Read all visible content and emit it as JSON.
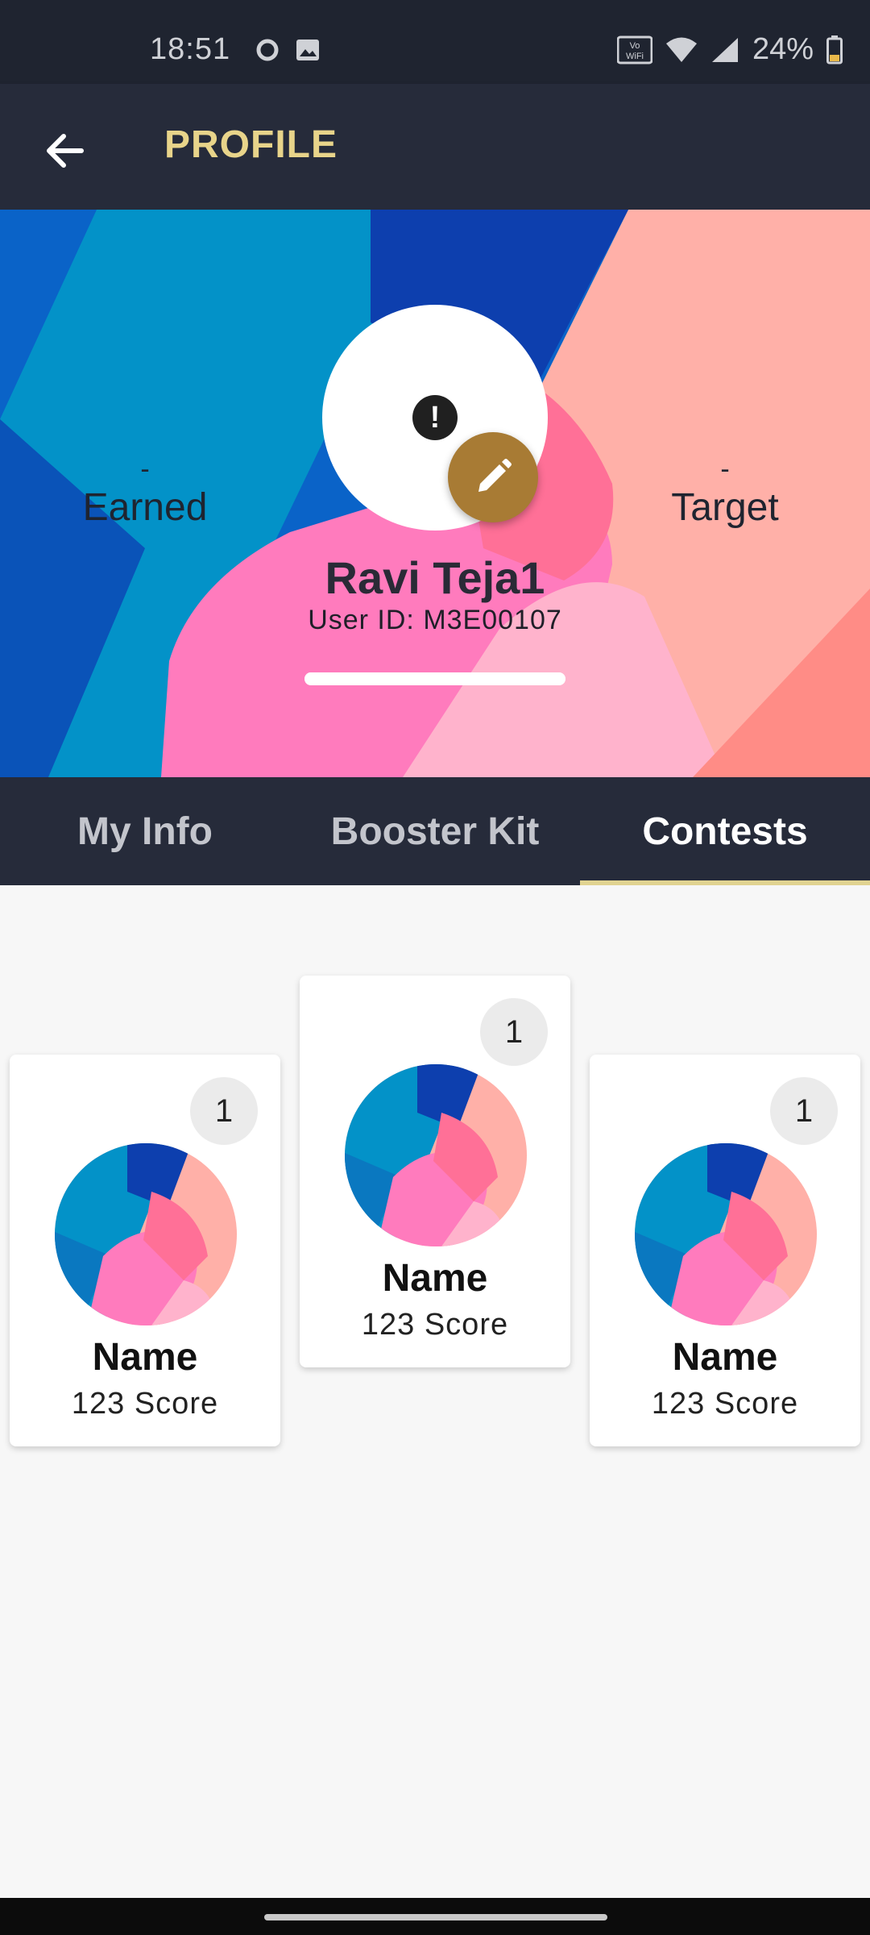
{
  "status_bar": {
    "time": "18:51",
    "battery": "24%"
  },
  "app_bar": {
    "title": "PROFILE"
  },
  "profile": {
    "earned_value": "-",
    "earned_label": "Earned",
    "target_value": "-",
    "target_label": "Target",
    "name": "Ravi Teja1",
    "user_id": "User ID: M3E00107",
    "progress_fraction": 1.0
  },
  "tabs": [
    {
      "label": "My Info"
    },
    {
      "label": "Booster Kit"
    },
    {
      "label": "Contests"
    }
  ],
  "active_tab": "Contests",
  "leaderboard": [
    {
      "rank": "1",
      "name": "Name",
      "score": "123 Score"
    },
    {
      "rank": "1",
      "name": "Name",
      "score": "123 Score"
    },
    {
      "rank": "1",
      "name": "Name",
      "score": "123 Score"
    }
  ],
  "colors": {
    "app_bar_bg": "#262b3a",
    "title_accent": "#e8d48a",
    "edit_button": "#a87b34",
    "tab_indicator": "#e1d391"
  }
}
